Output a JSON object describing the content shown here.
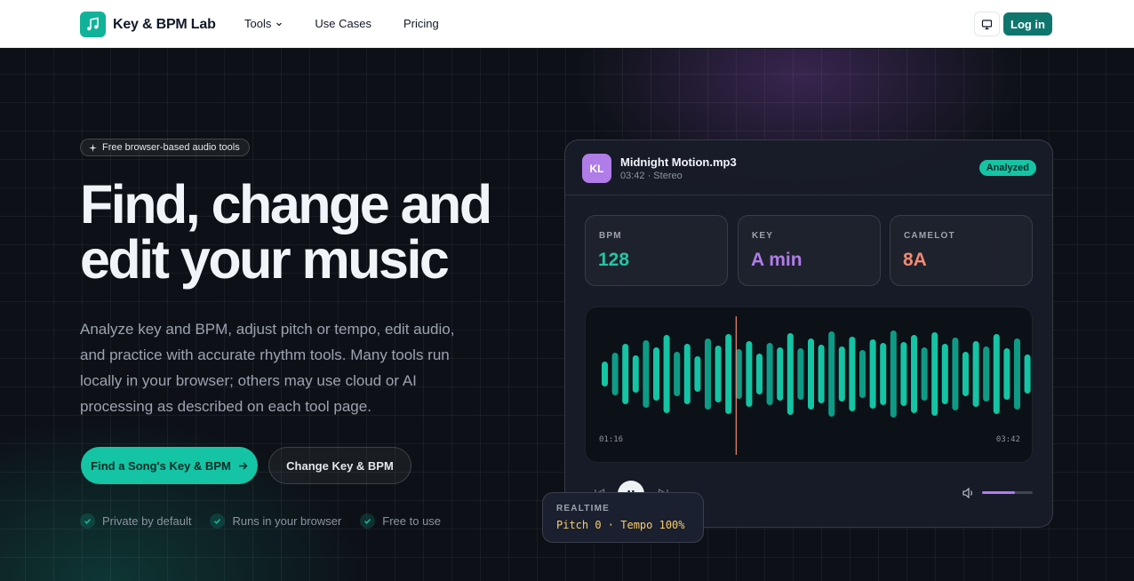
{
  "brand": {
    "name": "Key & BPM Lab",
    "logo_icon": "music-note-icon",
    "logo_color": "#10b39a"
  },
  "nav": {
    "items": [
      {
        "label": "Tools",
        "has_dropdown": true
      },
      {
        "label": "Use Cases"
      },
      {
        "label": "Pricing"
      }
    ],
    "display_icon": "monitor-icon",
    "login_label": "Log in"
  },
  "hero": {
    "badge": "Free browser-based audio tools",
    "headline_line1": "Find, change and",
    "headline_line2": "edit your music",
    "subtext": "Analyze key and BPM, adjust pitch or tempo, edit audio, and practice with accurate rhythm tools. Many tools run locally in your browser; others may use cloud or AI processing as described on each tool page.",
    "cta_primary": "Find a Song's Key & BPM",
    "cta_secondary": "Change Key & BPM",
    "features": [
      "Private by default",
      "Runs in your browser",
      "Free to use"
    ]
  },
  "player": {
    "avatar_initials": "KL",
    "file_name": "Midnight Motion.mp3",
    "file_meta": "03:42 · Stereo",
    "status": "Analyzed",
    "stats": [
      {
        "label": "BPM",
        "value": "128",
        "color": "#22c5a5"
      },
      {
        "label": "KEY",
        "value": "A min",
        "color": "#b07ce8"
      },
      {
        "label": "CAMELOT",
        "value": "8A",
        "color": "#f08a73"
      }
    ],
    "time_start": "01:16",
    "time_end": "03:42",
    "playhead_position": 0.336,
    "volume_level": 0.65,
    "accent_colors": {
      "wave": "#14c4a4",
      "playhead": "#f08a73",
      "volume": "#b07ce8"
    }
  },
  "realtime": {
    "label": "REALTIME",
    "value": "Pitch 0 · Tempo 100%"
  }
}
